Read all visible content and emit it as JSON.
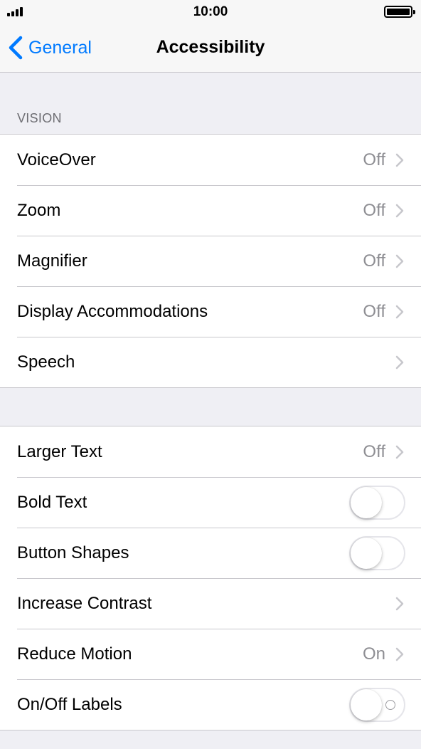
{
  "status_bar": {
    "time": "10:00"
  },
  "nav": {
    "back_label": "General",
    "title": "Accessibility"
  },
  "vision": {
    "header": "VISION",
    "rows": [
      {
        "label": "VoiceOver",
        "value": "Off"
      },
      {
        "label": "Zoom",
        "value": "Off"
      },
      {
        "label": "Magnifier",
        "value": "Off"
      },
      {
        "label": "Display Accommodations",
        "value": "Off"
      },
      {
        "label": "Speech",
        "value": ""
      }
    ]
  },
  "text_settings": {
    "rows": [
      {
        "label": "Larger Text",
        "value": "Off"
      },
      {
        "label": "Bold Text",
        "toggle": false
      },
      {
        "label": "Button Shapes",
        "toggle": false
      },
      {
        "label": "Increase Contrast",
        "value": ""
      },
      {
        "label": "Reduce Motion",
        "value": "On"
      },
      {
        "label": "On/Off Labels",
        "toggle": false
      }
    ]
  },
  "colors": {
    "accent": "#007aff",
    "secondary_text": "#8e8e93",
    "background": "#efeff4"
  },
  "icons": {
    "back": "chevron-left-icon",
    "disclosure": "chevron-right-icon",
    "signal": "signal-icon",
    "battery": "battery-icon"
  }
}
